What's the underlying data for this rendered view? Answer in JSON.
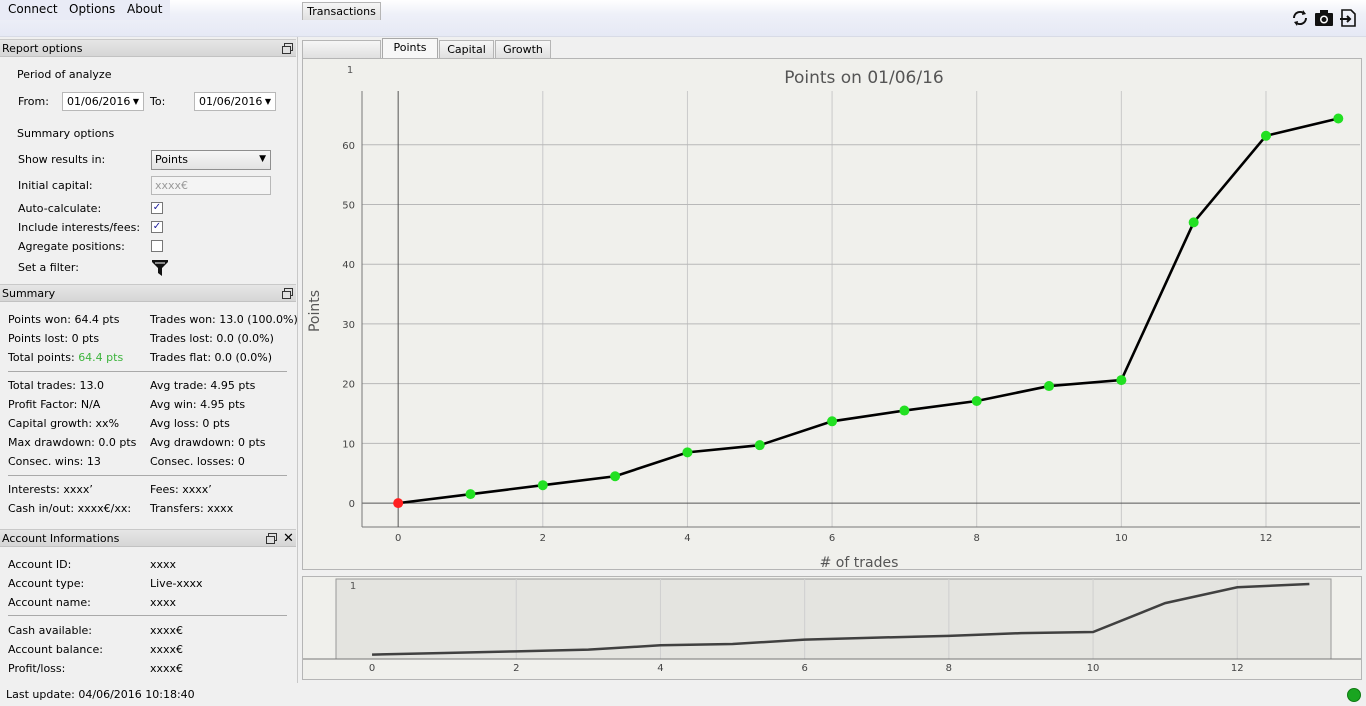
{
  "menu": {
    "items": [
      "Connect",
      "Options",
      "About"
    ]
  },
  "toolbar": {
    "icons": [
      "refresh-icon",
      "camera-icon",
      "exit-icon"
    ]
  },
  "report_options": {
    "title": "Report options",
    "period_label": "Period of analyze",
    "from_label": "From:",
    "from_value": "01/06/2016",
    "to_label": "To:",
    "to_value": "01/06/2016",
    "summary_options_label": "Summary options",
    "show_results_label": "Show results in:",
    "show_results_value": "Points",
    "initial_capital_label": "Initial capital:",
    "initial_capital_placeholder": "xxxx€",
    "auto_calc_label": "Auto-calculate:",
    "auto_calc_checked": true,
    "include_fees_label": "Include interests/fees:",
    "include_fees_checked": true,
    "aggregate_label": "Agregate positions:",
    "aggregate_checked": false,
    "filter_label": "Set a filter:"
  },
  "summary": {
    "title": "Summary",
    "points_won": "Points won: 64.4 pts",
    "trades_won": "Trades won: 13.0 (100.0%)",
    "points_lost": "Points lost: 0 pts",
    "trades_lost": "Trades lost: 0.0 (0.0%)",
    "total_points_label": "Total points:",
    "total_points_value": "64.4 pts",
    "total_points_color": "#3cb43c",
    "trades_flat": "Trades flat: 0.0 (0.0%)",
    "total_trades": "Total trades: 13.0",
    "avg_trade": "Avg trade: 4.95 pts",
    "profit_factor": "Profit Factor: N/A",
    "avg_win": "Avg win: 4.95 pts",
    "capital_growth": "Capital growth: xx%",
    "avg_loss": "Avg loss: 0 pts",
    "max_drawdown": "Max drawdown: 0.0 pts",
    "avg_drawdown": "Avg drawdown: 0 pts",
    "consec_wins": "Consec. wins: 13",
    "consec_losses": "Consec. losses: 0",
    "interests": "Interests: xxxx’",
    "fees": "Fees: xxxx’",
    "cash_inout": "Cash in/out: xxxx€/xx:",
    "transfers": "Transfers: xxxx"
  },
  "account": {
    "title": "Account Informations",
    "rows": [
      {
        "label": "Account ID:",
        "value": "xxxx"
      },
      {
        "label": "Account type:",
        "value": "Live-xxxx"
      },
      {
        "label": "Account name:",
        "value": "xxxx"
      },
      {
        "label": "Cash available:",
        "value": "xxxx€"
      },
      {
        "label": "Account balance:",
        "value": "xxxx€"
      },
      {
        "label": "Profit/loss:",
        "value": "xxxx€"
      }
    ]
  },
  "tabs": [
    {
      "label": "Transactions",
      "active": false
    },
    {
      "label": "Points",
      "active": true
    },
    {
      "label": "Capital",
      "active": false
    },
    {
      "label": "Growth",
      "active": false
    }
  ],
  "status": {
    "last_update": "Last update: 04/06/2016 10:18:40",
    "connection_color": "#19a520"
  },
  "chart_data": {
    "type": "line",
    "title": "Points on 01/06/16",
    "xlabel": "# of trades",
    "ylabel": "Points",
    "corner_label": "1",
    "x": [
      0,
      1,
      2,
      3,
      4,
      5,
      6,
      7,
      8,
      9,
      10,
      11,
      12,
      13
    ],
    "y": [
      0,
      1.5,
      3,
      4.5,
      8.5,
      9.7,
      13.7,
      15.5,
      17.1,
      19.6,
      20.6,
      47,
      61.5,
      64.4
    ],
    "point_colors": [
      "#ff2020",
      "#22e022",
      "#22e022",
      "#22e022",
      "#22e022",
      "#22e022",
      "#22e022",
      "#22e022",
      "#22e022",
      "#22e022",
      "#22e022",
      "#22e022",
      "#22e022",
      "#22e022"
    ],
    "xlim": [
      -0.5,
      13.3
    ],
    "ylim": [
      -4,
      69
    ],
    "xticks": [
      0,
      2,
      4,
      6,
      8,
      10,
      12
    ],
    "yticks": [
      0,
      10,
      20,
      30,
      40,
      50,
      60
    ],
    "grid": true,
    "overview": {
      "xticks": [
        0,
        2,
        4,
        6,
        8,
        10,
        12
      ]
    }
  }
}
